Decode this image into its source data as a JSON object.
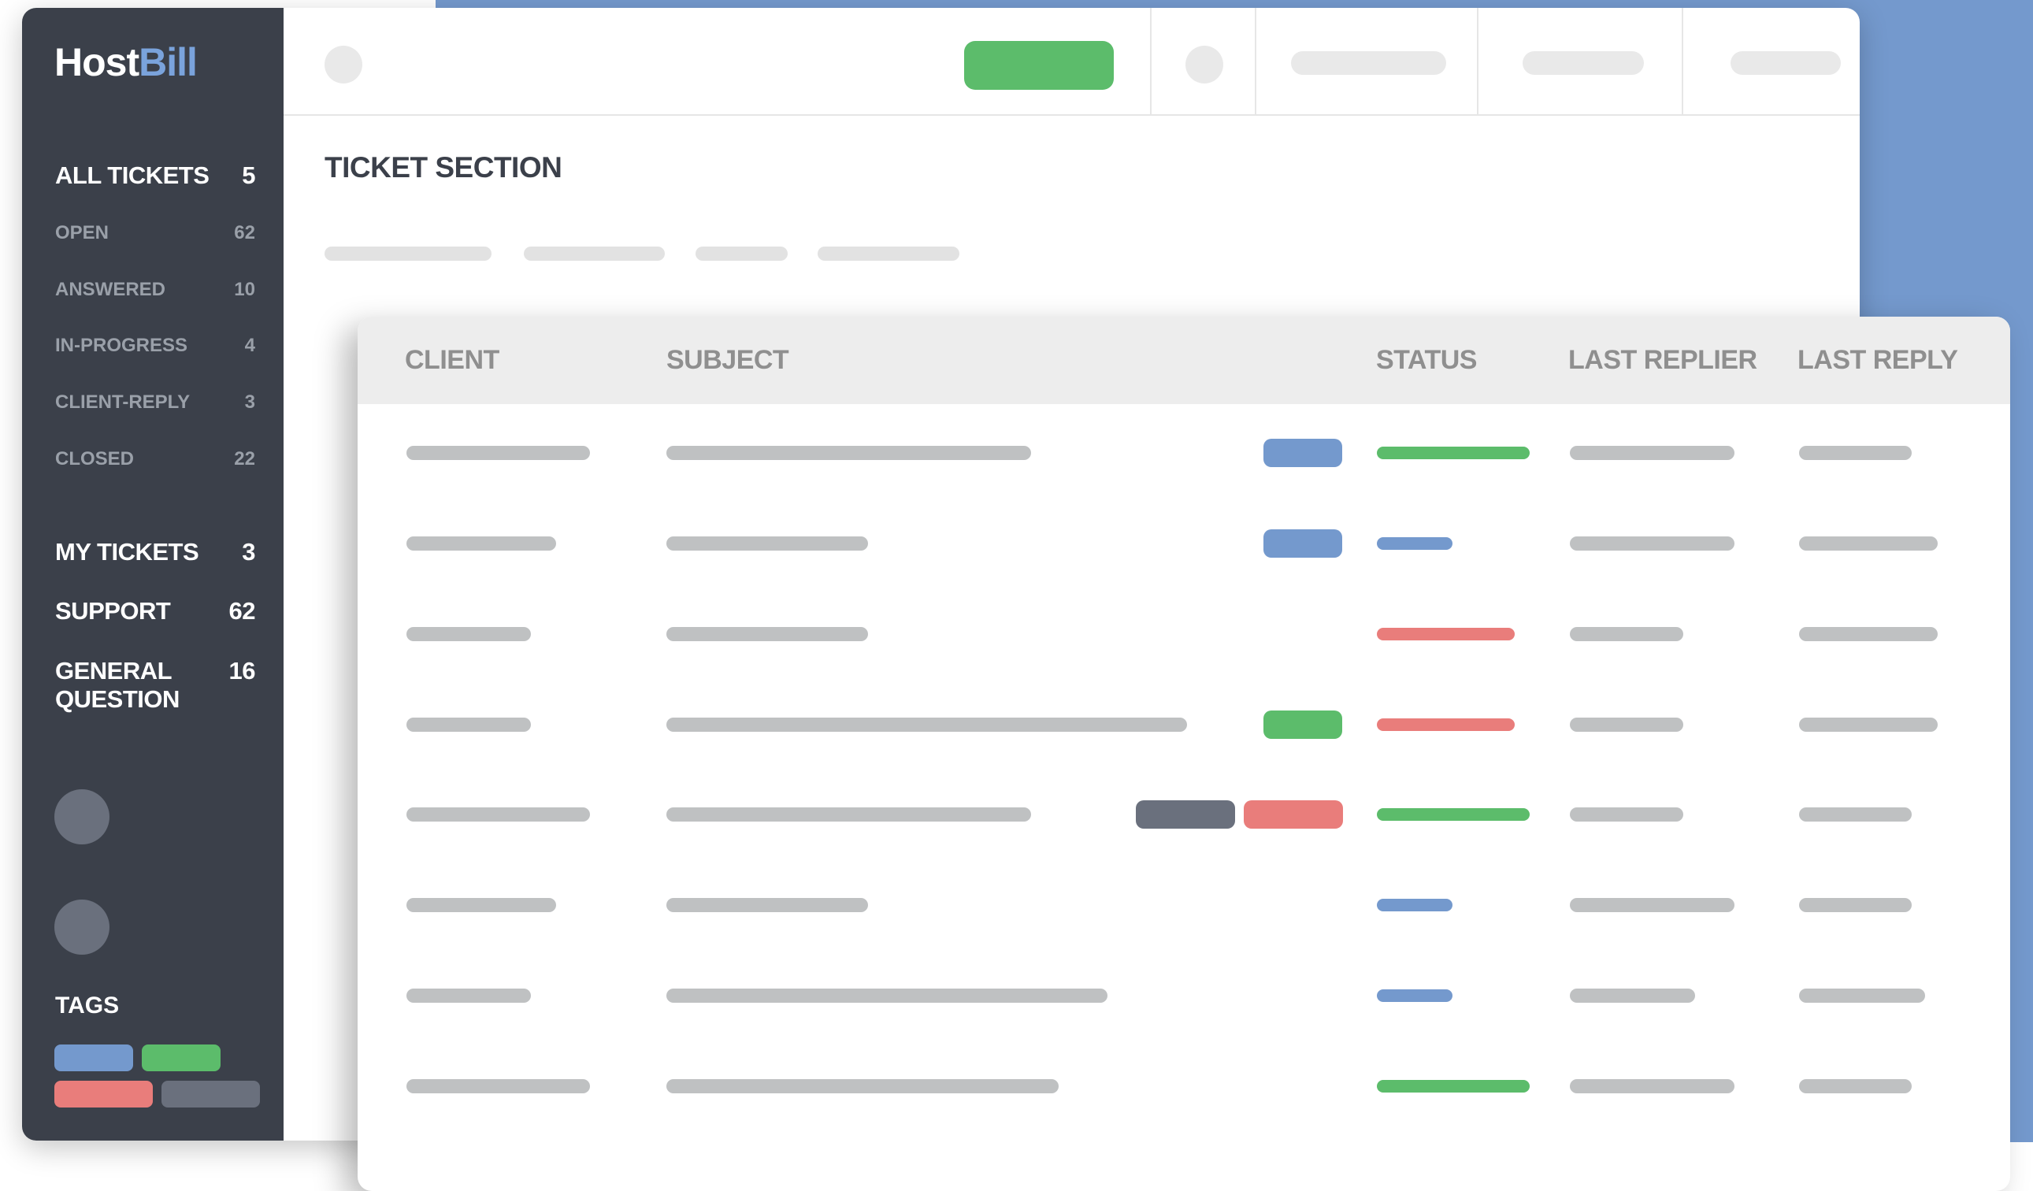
{
  "app": {
    "logo_host": "Host",
    "logo_bill": "Bill"
  },
  "sidebar": {
    "items": [
      {
        "label": "ALL TICKETS",
        "count": "5",
        "style": "major"
      },
      {
        "label": "OPEN",
        "count": "62",
        "style": "minor"
      },
      {
        "label": "ANSWERED",
        "count": "10",
        "style": "minor"
      },
      {
        "label": "IN-PROGRESS",
        "count": "4",
        "style": "minor"
      },
      {
        "label": "CLIENT-REPLY",
        "count": "3",
        "style": "minor"
      },
      {
        "label": "CLOSED",
        "count": "22",
        "style": "minor"
      },
      {
        "label": "MY TICKETS",
        "count": "3",
        "style": "major"
      },
      {
        "label": "SUPPORT",
        "count": "62",
        "style": "major"
      },
      {
        "label": "GENERAL QUESTION",
        "count": "16",
        "style": "major"
      }
    ],
    "tags_title": "TAGS",
    "tag_colors": [
      "#7499cd",
      "#5cbc6b",
      "#e97d7b",
      "#6a707d"
    ]
  },
  "main": {
    "section_title": "TICKET SECTION"
  },
  "table": {
    "columns": [
      "CLIENT",
      "SUBJECT",
      "STATUS",
      "LAST REPLIER",
      "LAST REPLY"
    ],
    "rows": [
      {
        "status_color": "#5cbc6b",
        "chips": [
          "#7499cd"
        ]
      },
      {
        "status_color": "#7499cd",
        "chips": [
          "#7499cd"
        ]
      },
      {
        "status_color": "#e97d7b",
        "chips": []
      },
      {
        "status_color": "#e97d7b",
        "chips": [
          "#5cbc6b"
        ]
      },
      {
        "status_color": "#5cbc6b",
        "chips": [
          "#6a707d",
          "#e97d7b"
        ]
      },
      {
        "status_color": "#7499cd",
        "chips": []
      },
      {
        "status_color": "#7499cd",
        "chips": []
      },
      {
        "status_color": "#5cbc6b",
        "chips": []
      }
    ]
  },
  "colors": {
    "sidebar_bg": "#3b404a",
    "accent_blue": "#7499cd",
    "accent_green": "#5cbc6b",
    "accent_red": "#e97d7b",
    "accent_gray": "#6a707d",
    "placeholder": "#bfc1c2"
  }
}
